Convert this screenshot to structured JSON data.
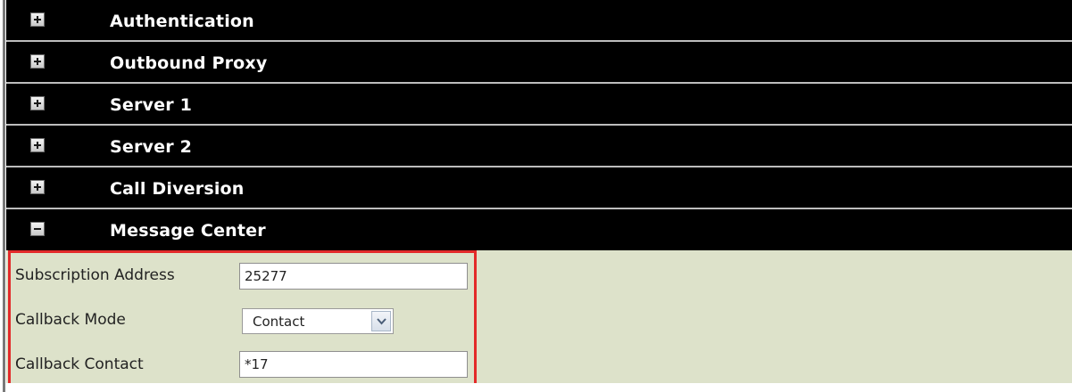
{
  "sections": [
    {
      "title": "Authentication",
      "state": "collapsed",
      "icon": "plus-icon"
    },
    {
      "title": "Outbound Proxy",
      "state": "collapsed",
      "icon": "plus-icon"
    },
    {
      "title": "Server 1",
      "state": "collapsed",
      "icon": "plus-icon"
    },
    {
      "title": "Server 2",
      "state": "collapsed",
      "icon": "plus-icon"
    },
    {
      "title": "Call Diversion",
      "state": "collapsed",
      "icon": "plus-icon"
    },
    {
      "title": "Message Center",
      "state": "expanded",
      "icon": "minus-icon"
    }
  ],
  "message_center": {
    "subscription_address_label": "Subscription Address",
    "subscription_address_value": "25277",
    "callback_mode_label": "Callback Mode",
    "callback_mode_value": "Contact",
    "callback_contact_label": "Callback Contact",
    "callback_contact_value": "*17"
  },
  "colors": {
    "header_bg": "#000000",
    "header_text": "#ffffff",
    "content_bg": "#dde2ca",
    "highlight_border": "#e32a2a"
  }
}
